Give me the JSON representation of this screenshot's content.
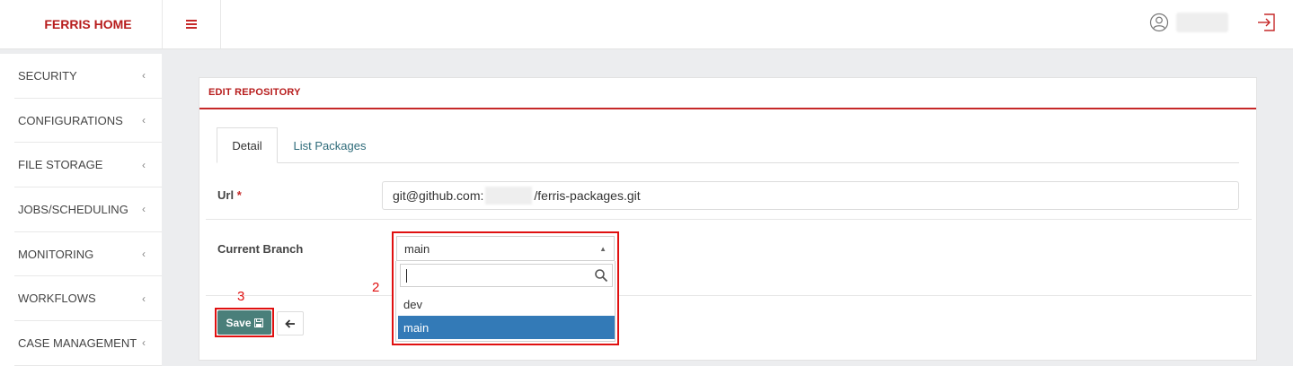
{
  "header": {
    "brand": "FERRIS HOME"
  },
  "sidebar": {
    "items": [
      {
        "label": "SECURITY"
      },
      {
        "label": "CONFIGURATIONS"
      },
      {
        "label": "FILE STORAGE"
      },
      {
        "label": "JOBS/SCHEDULING"
      },
      {
        "label": "MONITORING"
      },
      {
        "label": "WORKFLOWS"
      },
      {
        "label": "CASE MANAGEMENT"
      }
    ],
    "chevron": "‹"
  },
  "panel": {
    "title": "EDIT REPOSITORY"
  },
  "tabs": [
    {
      "label": "Detail"
    },
    {
      "label": "List Packages"
    }
  ],
  "form": {
    "url_label": "Url",
    "required_mark": "*",
    "url_prefix": "git@github.com:",
    "url_suffix": "/ferris-packages.git",
    "branch_label": "Current Branch",
    "branch_value": "main",
    "options": [
      {
        "label": "dev"
      },
      {
        "label": "main"
      }
    ]
  },
  "buttons": {
    "save": "Save"
  },
  "annotations": {
    "two": "2",
    "three": "3"
  },
  "colors": {
    "brand": "#b71c1c",
    "save_button": "#4a7f7a",
    "selected_option": "#337ab7",
    "annotation": "#e01010"
  }
}
